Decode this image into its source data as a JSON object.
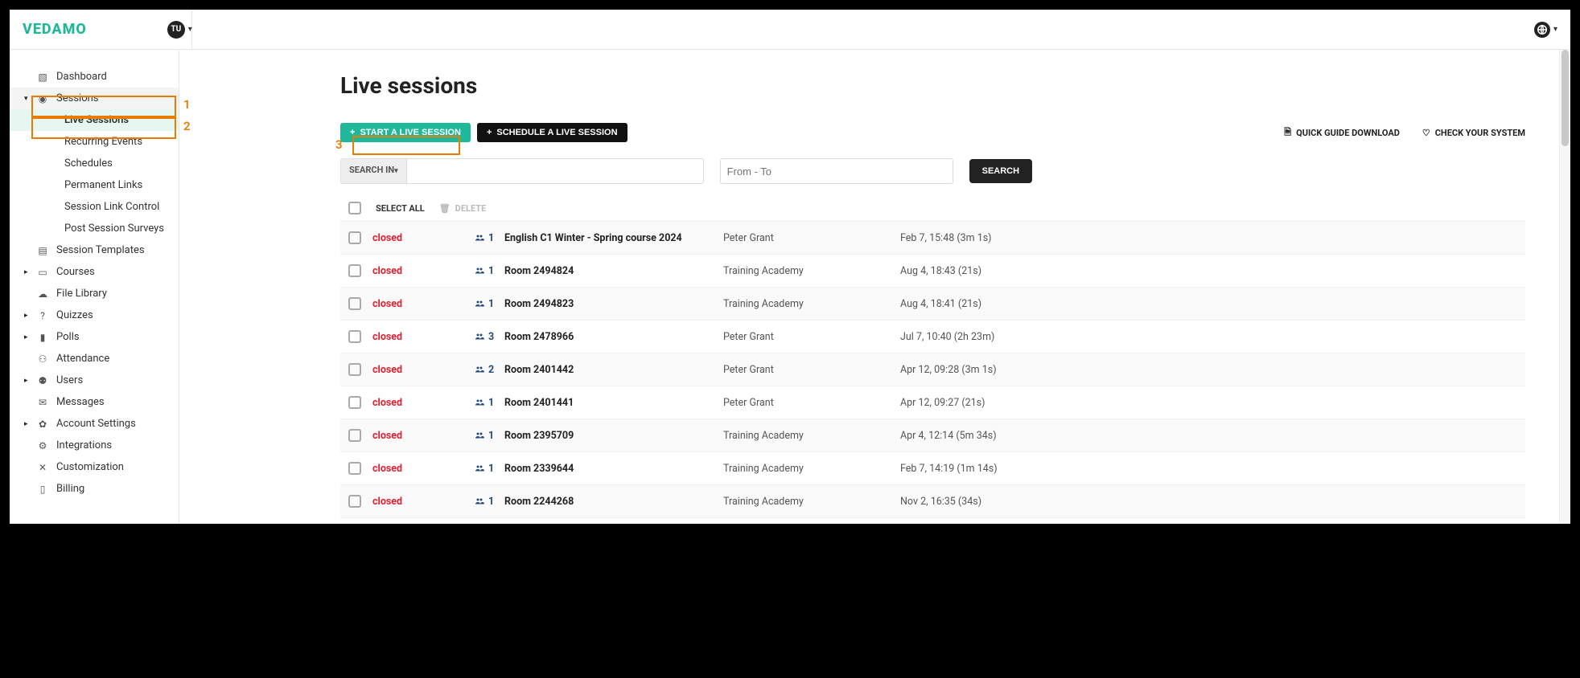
{
  "brand": "VEDAMO",
  "avatar_initials": "TU",
  "page_title": "Live sessions",
  "annotations": {
    "a1": "1",
    "a2": "2",
    "a3": "3"
  },
  "buttons": {
    "start": "START A LIVE SESSION",
    "schedule": "SCHEDULE A LIVE SESSION",
    "quick_guide": "QUICK GUIDE DOWNLOAD",
    "check_system": "CHECK YOUR SYSTEM",
    "search_in": "SEARCH IN",
    "search": "SEARCH",
    "select_all": "SELECT ALL",
    "delete": "DELETE"
  },
  "placeholders": {
    "date": "From - To"
  },
  "sidebar": {
    "dashboard": "Dashboard",
    "sessions": "Sessions",
    "live_sessions": "Live Sessions",
    "recurring": "Recurring Events",
    "schedules": "Schedules",
    "perm_links": "Permanent Links",
    "link_control": "Session Link Control",
    "surveys": "Post Session Surveys",
    "templates": "Session Templates",
    "courses": "Courses",
    "file_library": "File Library",
    "quizzes": "Quizzes",
    "polls": "Polls",
    "attendance": "Attendance",
    "users": "Users",
    "messages": "Messages",
    "account": "Account Settings",
    "integrations": "Integrations",
    "customization": "Customization",
    "billing": "Billing"
  },
  "sessions": [
    {
      "status": "closed",
      "count": "1",
      "title": "English C1 Winter - Spring course 2024",
      "who": "Peter Grant",
      "when": "Feb 7, 15:48 (3m 1s)"
    },
    {
      "status": "closed",
      "count": "1",
      "title": "Room 2494824",
      "who": "Training Academy",
      "when": "Aug 4, 18:43 (21s)"
    },
    {
      "status": "closed",
      "count": "1",
      "title": "Room 2494823",
      "who": "Training Academy",
      "when": "Aug 4, 18:41 (21s)"
    },
    {
      "status": "closed",
      "count": "3",
      "title": "Room 2478966",
      "who": "Peter Grant",
      "when": "Jul 7, 10:40 (2h 23m)"
    },
    {
      "status": "closed",
      "count": "2",
      "title": "Room 2401442",
      "who": "Peter Grant",
      "when": "Apr 12, 09:28 (3m 1s)"
    },
    {
      "status": "closed",
      "count": "1",
      "title": "Room 2401441",
      "who": "Peter Grant",
      "when": "Apr 12, 09:27 (21s)"
    },
    {
      "status": "closed",
      "count": "1",
      "title": "Room 2395709",
      "who": "Training Academy",
      "when": "Apr 4, 12:14 (5m 34s)"
    },
    {
      "status": "closed",
      "count": "1",
      "title": "Room 2339644",
      "who": "Training Academy",
      "when": "Feb 7, 14:19 (1m 14s)"
    },
    {
      "status": "closed",
      "count": "1",
      "title": "Room 2244268",
      "who": "Training Academy",
      "when": "Nov 2, 16:35 (34s)"
    }
  ]
}
